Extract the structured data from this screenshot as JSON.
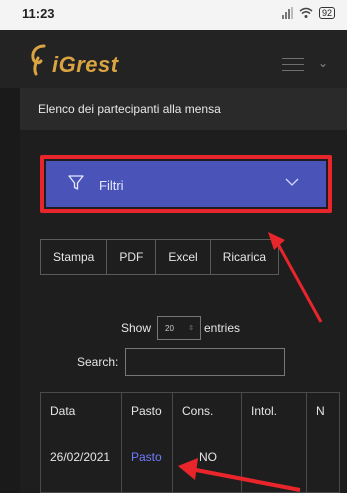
{
  "status_bar": {
    "time": "11:23",
    "battery": "92"
  },
  "header": {
    "app_name": "iGrest"
  },
  "page": {
    "title": "Elenco dei partecipanti alla mensa"
  },
  "filter": {
    "label": "Filtri"
  },
  "export_buttons": [
    "Stampa",
    "PDF",
    "Excel",
    "Ricarica"
  ],
  "entries": {
    "show_label": "Show",
    "value": "20",
    "entries_label": "entries"
  },
  "search": {
    "label": "Search:",
    "placeholder": ""
  },
  "table": {
    "headers": [
      "Data",
      "Pasto",
      "Cons.",
      "Intol.",
      "N"
    ],
    "rows": [
      {
        "data": "26/02/2021",
        "pasto": "Pasto",
        "cons": "NO"
      }
    ]
  },
  "colors": {
    "accent": "#4a54b8",
    "highlight": "#e8252b",
    "logo": "#d9a441",
    "link": "#6f7bff"
  }
}
